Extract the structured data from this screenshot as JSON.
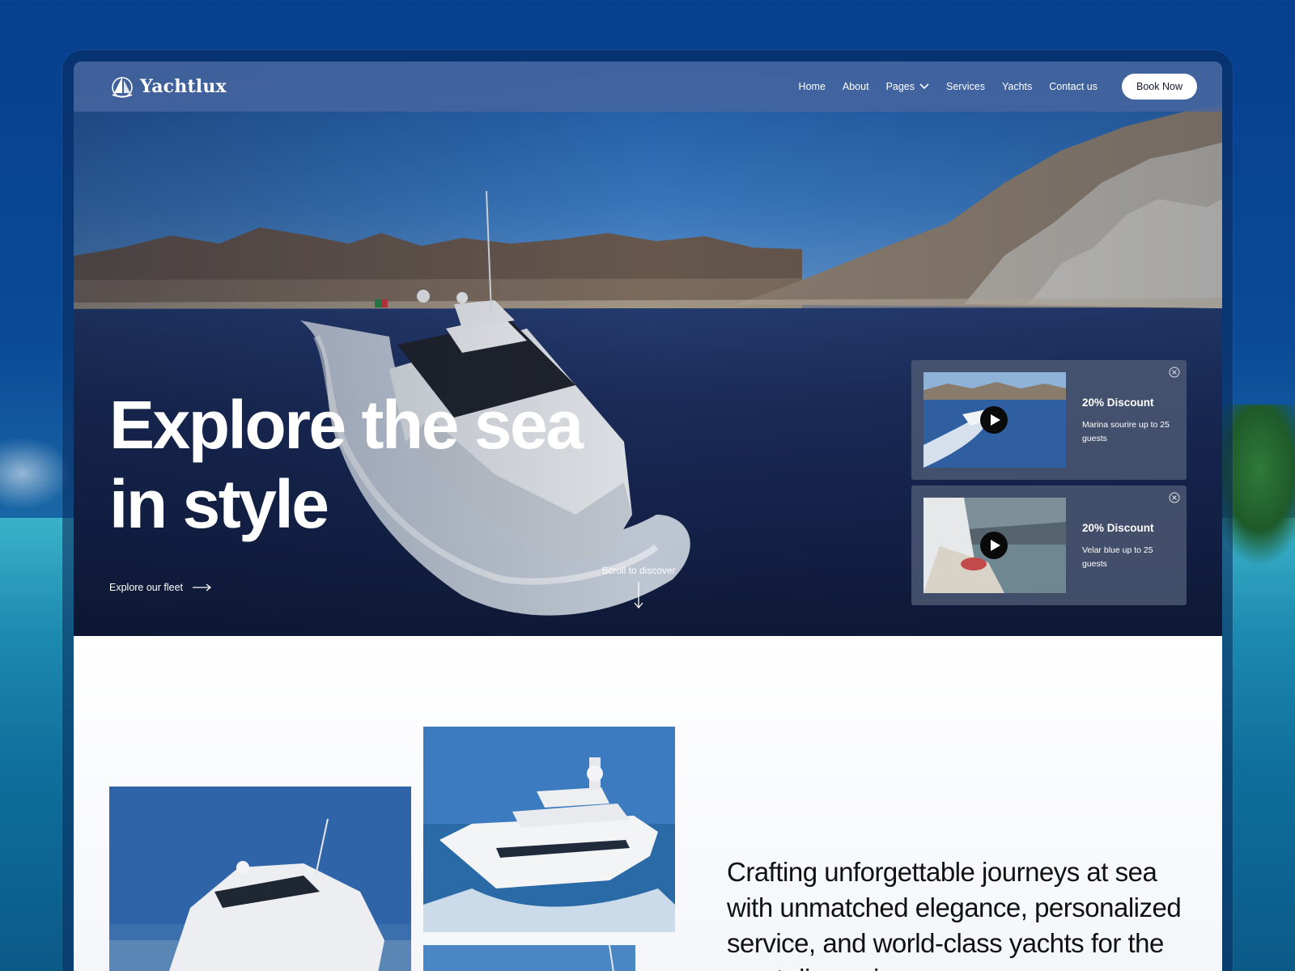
{
  "brand": {
    "name": "Yachtlux"
  },
  "nav": {
    "links": [
      {
        "label": "Home"
      },
      {
        "label": "About"
      },
      {
        "label": "Pages",
        "has_dropdown": true
      },
      {
        "label": "Services"
      },
      {
        "label": "Yachts"
      },
      {
        "label": "Contact us"
      }
    ],
    "cta": "Book Now"
  },
  "hero": {
    "title_line1": "Explore the sea",
    "title_line2": "in style",
    "explore_link": "Explore our fleet",
    "scroll_hint": "Scroll to discover"
  },
  "promos": [
    {
      "title": "20% Discount",
      "description": "Marina sourire up to 25 guests"
    },
    {
      "title": "20% Discount",
      "description": "Velar blue up to 25 guests"
    }
  ],
  "about": {
    "tagline": "Crafting unforgettable journeys at sea with unmatched elegance, personalized service, and world-class yachts for the most discerning"
  },
  "colors": {
    "nav_bg": "#4866a0",
    "cta_bg": "#ffffff",
    "hero_sea": "#1b2c5a",
    "page_bg": "#0a4a96"
  },
  "icons": [
    "sailboat-logo-icon",
    "chevron-down-icon",
    "arrow-right-icon",
    "arrow-down-icon",
    "play-icon",
    "close-icon"
  ]
}
